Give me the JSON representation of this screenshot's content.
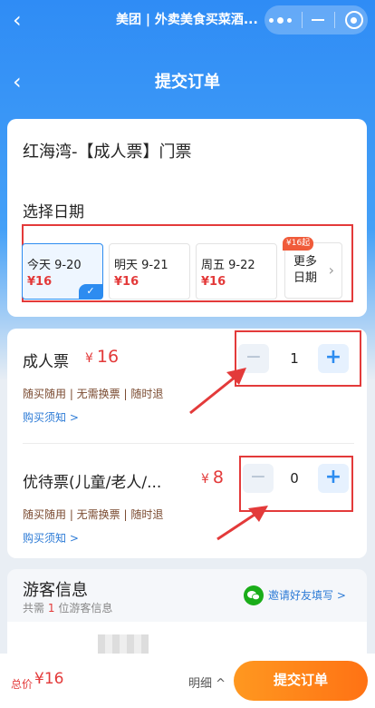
{
  "topbar": {
    "title": "美团 | 外卖美食买菜酒..."
  },
  "header": {
    "title": "提交订单"
  },
  "ticket": {
    "title": "红海湾-【成人票】门票",
    "date_label": "选择日期",
    "dates": [
      {
        "label": "今天 9-20",
        "price": "¥16",
        "selected": true
      },
      {
        "label": "明天 9-21",
        "price": "¥16",
        "selected": false
      },
      {
        "label": "周五 9-22",
        "price": "¥16",
        "selected": false
      }
    ],
    "more": {
      "label": "更多日期",
      "tag": "¥16起"
    }
  },
  "types": [
    {
      "name": "成人票",
      "price": "16",
      "yen": "¥",
      "features": "随买随用 | 无需换票 | 随时退",
      "link": "购买须知 >",
      "quantity": "1"
    },
    {
      "name": "优待票(儿童/老人/...",
      "price": "8",
      "yen": "¥",
      "features": "随买随用 | 无需换票 | 随时退",
      "link": "购买须知 >",
      "quantity": "0"
    }
  ],
  "visitor": {
    "title": "游客信息",
    "sub_prefix": "共需",
    "sub_count": "1",
    "sub_suffix": "位游客信息",
    "invite": "邀请好友填写 >"
  },
  "bottom": {
    "total_label": "总价",
    "total_value": "¥16",
    "detail": "明细 ^",
    "submit": "提交订单"
  },
  "colors": {
    "accent": "#2d8cf0",
    "price": "#e33a3a",
    "submit": "#ff7f17"
  }
}
